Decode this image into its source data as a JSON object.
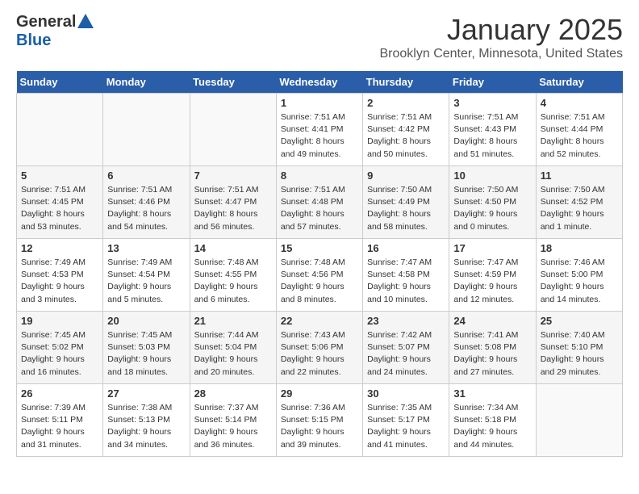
{
  "logo": {
    "general": "General",
    "blue": "Blue"
  },
  "title": "January 2025",
  "location": "Brooklyn Center, Minnesota, United States",
  "days_of_week": [
    "Sunday",
    "Monday",
    "Tuesday",
    "Wednesday",
    "Thursday",
    "Friday",
    "Saturday"
  ],
  "weeks": [
    [
      {
        "day": "",
        "sunrise": "",
        "sunset": "",
        "daylight": ""
      },
      {
        "day": "",
        "sunrise": "",
        "sunset": "",
        "daylight": ""
      },
      {
        "day": "",
        "sunrise": "",
        "sunset": "",
        "daylight": ""
      },
      {
        "day": "1",
        "sunrise": "Sunrise: 7:51 AM",
        "sunset": "Sunset: 4:41 PM",
        "daylight": "Daylight: 8 hours and 49 minutes."
      },
      {
        "day": "2",
        "sunrise": "Sunrise: 7:51 AM",
        "sunset": "Sunset: 4:42 PM",
        "daylight": "Daylight: 8 hours and 50 minutes."
      },
      {
        "day": "3",
        "sunrise": "Sunrise: 7:51 AM",
        "sunset": "Sunset: 4:43 PM",
        "daylight": "Daylight: 8 hours and 51 minutes."
      },
      {
        "day": "4",
        "sunrise": "Sunrise: 7:51 AM",
        "sunset": "Sunset: 4:44 PM",
        "daylight": "Daylight: 8 hours and 52 minutes."
      }
    ],
    [
      {
        "day": "5",
        "sunrise": "Sunrise: 7:51 AM",
        "sunset": "Sunset: 4:45 PM",
        "daylight": "Daylight: 8 hours and 53 minutes."
      },
      {
        "day": "6",
        "sunrise": "Sunrise: 7:51 AM",
        "sunset": "Sunset: 4:46 PM",
        "daylight": "Daylight: 8 hours and 54 minutes."
      },
      {
        "day": "7",
        "sunrise": "Sunrise: 7:51 AM",
        "sunset": "Sunset: 4:47 PM",
        "daylight": "Daylight: 8 hours and 56 minutes."
      },
      {
        "day": "8",
        "sunrise": "Sunrise: 7:51 AM",
        "sunset": "Sunset: 4:48 PM",
        "daylight": "Daylight: 8 hours and 57 minutes."
      },
      {
        "day": "9",
        "sunrise": "Sunrise: 7:50 AM",
        "sunset": "Sunset: 4:49 PM",
        "daylight": "Daylight: 8 hours and 58 minutes."
      },
      {
        "day": "10",
        "sunrise": "Sunrise: 7:50 AM",
        "sunset": "Sunset: 4:50 PM",
        "daylight": "Daylight: 9 hours and 0 minutes."
      },
      {
        "day": "11",
        "sunrise": "Sunrise: 7:50 AM",
        "sunset": "Sunset: 4:52 PM",
        "daylight": "Daylight: 9 hours and 1 minute."
      }
    ],
    [
      {
        "day": "12",
        "sunrise": "Sunrise: 7:49 AM",
        "sunset": "Sunset: 4:53 PM",
        "daylight": "Daylight: 9 hours and 3 minutes."
      },
      {
        "day": "13",
        "sunrise": "Sunrise: 7:49 AM",
        "sunset": "Sunset: 4:54 PM",
        "daylight": "Daylight: 9 hours and 5 minutes."
      },
      {
        "day": "14",
        "sunrise": "Sunrise: 7:48 AM",
        "sunset": "Sunset: 4:55 PM",
        "daylight": "Daylight: 9 hours and 6 minutes."
      },
      {
        "day": "15",
        "sunrise": "Sunrise: 7:48 AM",
        "sunset": "Sunset: 4:56 PM",
        "daylight": "Daylight: 9 hours and 8 minutes."
      },
      {
        "day": "16",
        "sunrise": "Sunrise: 7:47 AM",
        "sunset": "Sunset: 4:58 PM",
        "daylight": "Daylight: 9 hours and 10 minutes."
      },
      {
        "day": "17",
        "sunrise": "Sunrise: 7:47 AM",
        "sunset": "Sunset: 4:59 PM",
        "daylight": "Daylight: 9 hours and 12 minutes."
      },
      {
        "day": "18",
        "sunrise": "Sunrise: 7:46 AM",
        "sunset": "Sunset: 5:00 PM",
        "daylight": "Daylight: 9 hours and 14 minutes."
      }
    ],
    [
      {
        "day": "19",
        "sunrise": "Sunrise: 7:45 AM",
        "sunset": "Sunset: 5:02 PM",
        "daylight": "Daylight: 9 hours and 16 minutes."
      },
      {
        "day": "20",
        "sunrise": "Sunrise: 7:45 AM",
        "sunset": "Sunset: 5:03 PM",
        "daylight": "Daylight: 9 hours and 18 minutes."
      },
      {
        "day": "21",
        "sunrise": "Sunrise: 7:44 AM",
        "sunset": "Sunset: 5:04 PM",
        "daylight": "Daylight: 9 hours and 20 minutes."
      },
      {
        "day": "22",
        "sunrise": "Sunrise: 7:43 AM",
        "sunset": "Sunset: 5:06 PM",
        "daylight": "Daylight: 9 hours and 22 minutes."
      },
      {
        "day": "23",
        "sunrise": "Sunrise: 7:42 AM",
        "sunset": "Sunset: 5:07 PM",
        "daylight": "Daylight: 9 hours and 24 minutes."
      },
      {
        "day": "24",
        "sunrise": "Sunrise: 7:41 AM",
        "sunset": "Sunset: 5:08 PM",
        "daylight": "Daylight: 9 hours and 27 minutes."
      },
      {
        "day": "25",
        "sunrise": "Sunrise: 7:40 AM",
        "sunset": "Sunset: 5:10 PM",
        "daylight": "Daylight: 9 hours and 29 minutes."
      }
    ],
    [
      {
        "day": "26",
        "sunrise": "Sunrise: 7:39 AM",
        "sunset": "Sunset: 5:11 PM",
        "daylight": "Daylight: 9 hours and 31 minutes."
      },
      {
        "day": "27",
        "sunrise": "Sunrise: 7:38 AM",
        "sunset": "Sunset: 5:13 PM",
        "daylight": "Daylight: 9 hours and 34 minutes."
      },
      {
        "day": "28",
        "sunrise": "Sunrise: 7:37 AM",
        "sunset": "Sunset: 5:14 PM",
        "daylight": "Daylight: 9 hours and 36 minutes."
      },
      {
        "day": "29",
        "sunrise": "Sunrise: 7:36 AM",
        "sunset": "Sunset: 5:15 PM",
        "daylight": "Daylight: 9 hours and 39 minutes."
      },
      {
        "day": "30",
        "sunrise": "Sunrise: 7:35 AM",
        "sunset": "Sunset: 5:17 PM",
        "daylight": "Daylight: 9 hours and 41 minutes."
      },
      {
        "day": "31",
        "sunrise": "Sunrise: 7:34 AM",
        "sunset": "Sunset: 5:18 PM",
        "daylight": "Daylight: 9 hours and 44 minutes."
      },
      {
        "day": "",
        "sunrise": "",
        "sunset": "",
        "daylight": ""
      }
    ]
  ]
}
